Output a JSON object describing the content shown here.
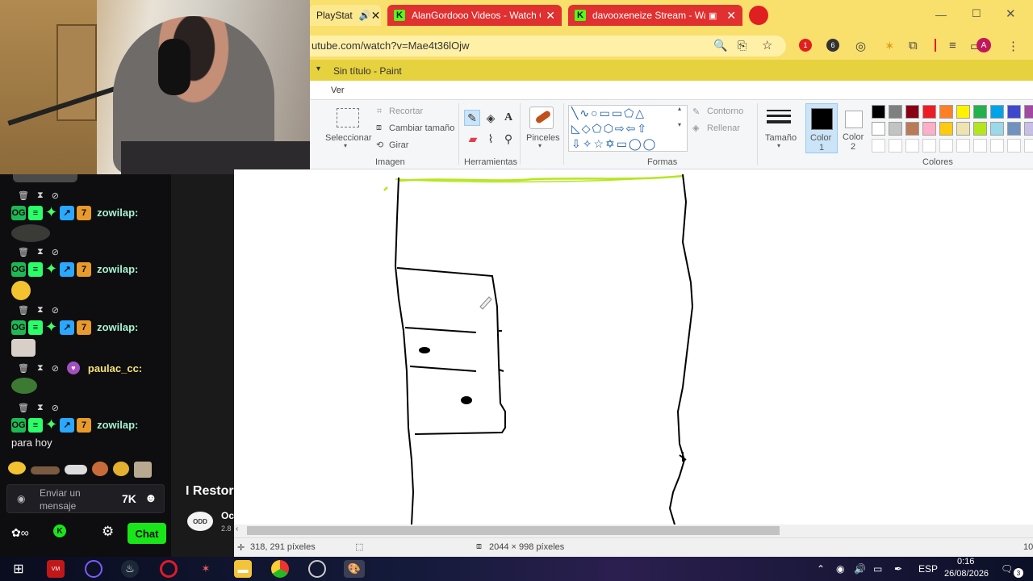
{
  "browser": {
    "tabs": [
      {
        "label": "PlayStat"
      },
      {
        "label": "AlanGordooo Videos - Watch O"
      },
      {
        "label": "davooxeneize Stream - Wat"
      }
    ],
    "url": "utube.com/watch?v=Mae4t36lOjw",
    "profile_initial": "A",
    "ext_badge_1": "1",
    "ext_badge_2": "6"
  },
  "paint": {
    "window_title": "Sin título - Paint",
    "ribbon_tab": "Ver",
    "image_group": {
      "select_label": "Seleccionar",
      "crop_label": "Recortar",
      "resize_label": "Cambiar tamaño",
      "rotate_label": "Girar",
      "group_label": "Imagen"
    },
    "tools_group_label": "Herramientas",
    "brushes_label": "Pinceles",
    "shapes": {
      "outline_label": "Contorno",
      "fill_label": "Rellenar",
      "group_label": "Formas"
    },
    "size_label": "Tamaño",
    "color1_label": "Color",
    "color1_num": "1",
    "color2_label": "Color",
    "color2_num": "2",
    "colors_group_label": "Colores",
    "palette_row1": [
      "#000000",
      "#7f7f7f",
      "#880015",
      "#ed1c24",
      "#ff7f27",
      "#fff200",
      "#22b14c",
      "#00a2e8",
      "#3f48cc",
      "#a349a4"
    ],
    "palette_row2": [
      "#ffffff",
      "#c3c3c3",
      "#b97a57",
      "#ffaec9",
      "#ffc90e",
      "#efe4b0",
      "#b5e61d",
      "#99d9ea",
      "#7092be",
      "#c8bfe7"
    ],
    "cursor_pos": "318, 291 píxeles",
    "canvas_size": "2044 × 998 píxeles",
    "zoom_partial": "10"
  },
  "chat": {
    "messages": [
      {
        "user": "zowilap:",
        "text": ""
      },
      {
        "user": "zowilap:",
        "text": ""
      },
      {
        "user": "zowilap:",
        "text": ""
      },
      {
        "user": "paulac_cc:",
        "text": ""
      },
      {
        "user": "zowilap:",
        "text": "para hoy"
      }
    ],
    "input_placeholder": "Enviar un mensaje",
    "send_button": "Chat"
  },
  "stream": {
    "title": "I Restor",
    "channel_logo": "ODD",
    "subtitle": "Oc",
    "sub2": "2.8"
  },
  "taskbar": {
    "lang": "ESP",
    "time": "0:16",
    "date": "26/08/2026",
    "notification_count": "3"
  }
}
